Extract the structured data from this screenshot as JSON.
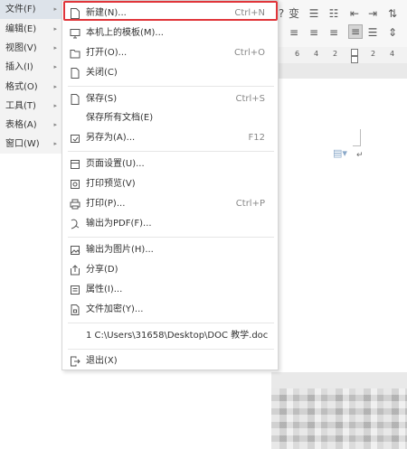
{
  "menubar": {
    "items": [
      {
        "label": "文件(F)",
        "active": true
      },
      {
        "label": "编辑(E)"
      },
      {
        "label": "视图(V)"
      },
      {
        "label": "插入(I)"
      },
      {
        "label": "格式(O)"
      },
      {
        "label": "工具(T)"
      },
      {
        "label": "表格(A)"
      },
      {
        "label": "窗口(W)"
      }
    ],
    "arrow": "▸"
  },
  "file_menu": {
    "items": [
      {
        "label": "新建(N)...",
        "shortcut": "Ctrl+N",
        "icon": "new-document-icon"
      },
      {
        "label": "本机上的模板(M)...",
        "shortcut": "",
        "icon": "template-icon"
      },
      {
        "label": "打开(O)...",
        "shortcut": "Ctrl+O",
        "icon": "folder-open-icon"
      },
      {
        "label": "关闭(C)",
        "shortcut": "",
        "icon": "close-document-icon"
      },
      {
        "label": "保存(S)",
        "shortcut": "Ctrl+S",
        "icon": "save-icon"
      },
      {
        "label": "保存所有文档(E)",
        "shortcut": "",
        "icon": ""
      },
      {
        "label": "另存为(A)...",
        "shortcut": "F12",
        "icon": "save-as-icon"
      },
      {
        "label": "页面设置(U)...",
        "shortcut": "",
        "icon": "page-setup-icon"
      },
      {
        "label": "打印预览(V)",
        "shortcut": "",
        "icon": "print-preview-icon"
      },
      {
        "label": "打印(P)...",
        "shortcut": "Ctrl+P",
        "icon": "printer-icon"
      },
      {
        "label": "输出为PDF(F)...",
        "shortcut": "",
        "icon": "export-pdf-icon"
      },
      {
        "label": "输出为图片(H)...",
        "shortcut": "",
        "icon": "export-image-icon"
      },
      {
        "label": "分享(D)",
        "shortcut": "",
        "icon": "share-icon"
      },
      {
        "label": "属性(I)...",
        "shortcut": "",
        "icon": "properties-icon"
      },
      {
        "label": "文件加密(Y)...",
        "shortcut": "",
        "icon": "encrypt-icon"
      },
      {
        "label": "1 C:\\Users\\31658\\Desktop\\DOC 教学.doc",
        "shortcut": "",
        "icon": ""
      },
      {
        "label": "退出(X)",
        "shortcut": "",
        "icon": "exit-icon"
      }
    ]
  },
  "ruler": {
    "numbers": [
      "6",
      "4",
      "2",
      "2",
      "4"
    ]
  },
  "colors": {
    "highlight": "#e0353a",
    "menubar_bg": "#f3f3f3",
    "active_bg": "#dde3ea"
  }
}
